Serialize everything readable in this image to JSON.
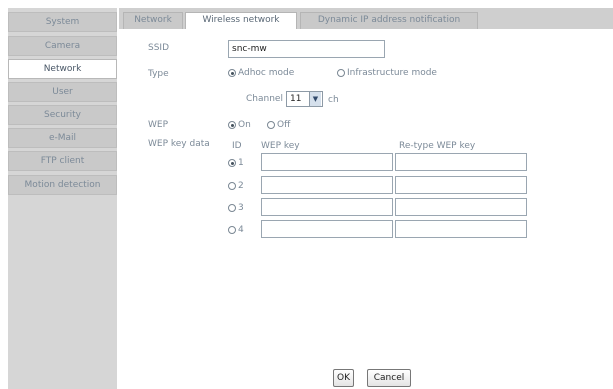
{
  "sidebar": {
    "items": [
      {
        "label": "System"
      },
      {
        "label": "Camera"
      },
      {
        "label": "Network"
      },
      {
        "label": "User"
      },
      {
        "label": "Security"
      },
      {
        "label": "e-Mail"
      },
      {
        "label": "FTP client"
      },
      {
        "label": "Motion detection"
      }
    ],
    "active": "Network"
  },
  "tabs": [
    {
      "label": "Network"
    },
    {
      "label": "Wireless network"
    },
    {
      "label": "Dynamic IP address notification"
    }
  ],
  "form": {
    "ssid_label": "SSID",
    "ssid_value": "snc-mw",
    "type_label": "Type",
    "type_options": [
      "Adhoc mode",
      "Infrastructure mode"
    ],
    "type_selected": "Adhoc mode",
    "channel_label": "Channel",
    "channel_value": "11",
    "channel_unit": "ch",
    "wep_label": "WEP",
    "wep_options": [
      "On",
      "Off"
    ],
    "wep_selected": "On",
    "wep_key_data_label": "WEP key data",
    "columns": {
      "id": "ID",
      "wep_key": "WEP key",
      "retype": "Re-type WEP key"
    },
    "key_ids": [
      "1",
      "2",
      "3",
      "4"
    ],
    "key_selected": "1"
  },
  "buttons": {
    "ok": "OK",
    "cancel": "Cancel"
  }
}
